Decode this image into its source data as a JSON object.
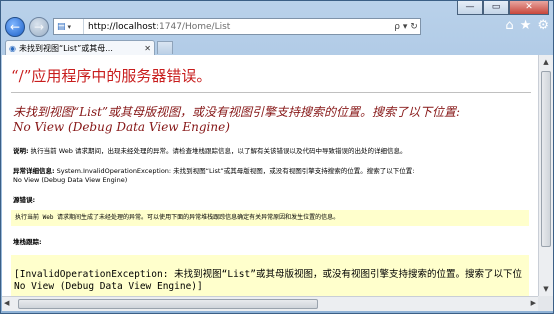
{
  "window_controls": {
    "minimize": "—",
    "maximize": "▭",
    "close": "✕"
  },
  "nav": {
    "back_icon": "left-arrow",
    "forward_icon": "right-arrow",
    "address_host": "http://localhost",
    "address_rest": ":1747/Home/List",
    "refresh_glyph": "ρ ▾ ↻"
  },
  "toolbar": {
    "home": "⌂",
    "favorites": "★",
    "tools": "⚙"
  },
  "tab": {
    "label": "未找到视图“List”或其母...",
    "close": "✕"
  },
  "page": {
    "title": "“/”应用程序中的服务器错误。",
    "heading": "未找到视图“List”或其母版视图，或没有视图引擎支持搜索的位置。搜索了以下位置:\nNo View (Debug Data View Engine)",
    "desc_label": "说明:",
    "desc_text": " 执行当前 Web 请求期间，出现未经处理的异常。请检查堆栈跟踪信息，以了解有关该错误以及代码中导致错误的出处的详细信息。",
    "exception_label": "异常详细信息:",
    "exception_text": " System.InvalidOperationException: 未找到视图“List”或其母版视图，或没有视图引擎支持搜索的位置。搜索了以下位置:",
    "exception_text2": "No View (Debug Data View Engine)",
    "source_label": "源错误:",
    "source_code": "执行当前 Web 请求期间生成了未经处理的异常。可以使用下面的异常堆栈跟踪信息确定有关异常原因和发生位置的信息。",
    "stack_label": "堆栈跟踪:",
    "stack_line1": "[InvalidOperationException: 未找到视图“List”或其母版视图，或没有视图引擎支持搜索的位置。搜索了以下位",
    "stack_line2": "No View (Debug Data View Engine)]"
  }
}
